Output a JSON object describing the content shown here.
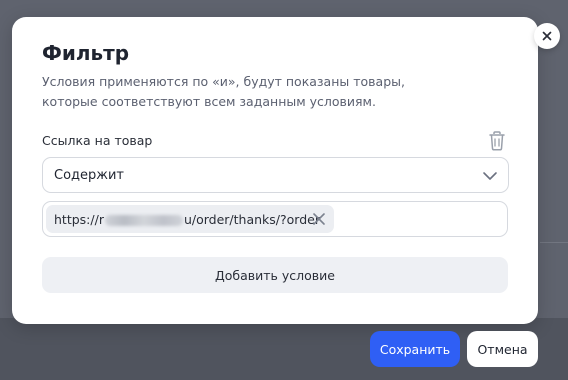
{
  "dialog": {
    "title": "Фильтр",
    "description": "Условия применяются по «и», будут показаны товары, которые соответствуют всем заданным условиям.",
    "close_icon": "close-icon",
    "condition": {
      "field_label": "Ссылка на товар",
      "delete_icon": "trash-icon",
      "operator_value": "Содержит",
      "dropdown_icon": "chevron-down-icon",
      "tag": {
        "prefix": "https://",
        "visible_start": "r",
        "suffix": "u/order/thanks/?order",
        "remove_icon": "close-icon"
      }
    },
    "add_condition_label": "Добавить условие"
  },
  "footer": {
    "save_label": "Сохранить",
    "cancel_label": "Отмена"
  },
  "colors": {
    "primary": "#2f5ff5",
    "overlay": "#5f636e"
  }
}
